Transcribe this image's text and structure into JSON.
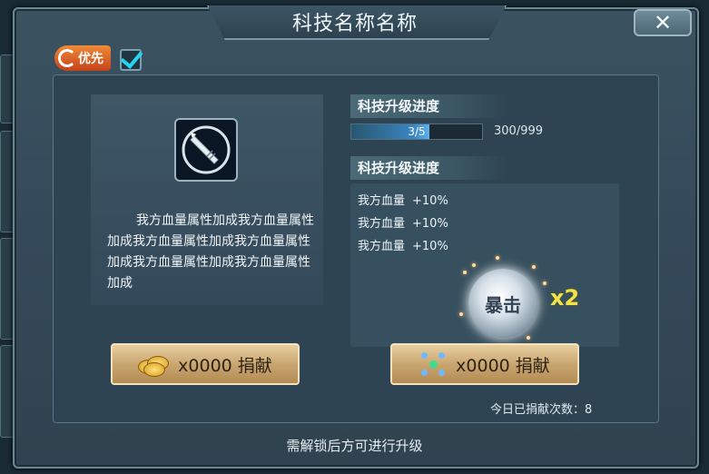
{
  "window": {
    "title": "科技名称名称",
    "close_icon": "close-icon"
  },
  "priority": {
    "label": "优先",
    "checked": true
  },
  "tech": {
    "icon": "bullet-icon",
    "description": "我方血量属性加成我方血量属性加成我方血量属性加成我方血量属性加成我方血量属性加成我方血量属性加成"
  },
  "progress": {
    "header": "科技升级进度",
    "level_text": "3/5",
    "level_fraction": 0.6,
    "exp_text": "300/999"
  },
  "attributes": {
    "header": "科技升级进度",
    "items": [
      {
        "name": "我方血量",
        "value": "+10%"
      },
      {
        "name": "我方血量",
        "value": "+10%"
      },
      {
        "name": "我方血量",
        "value": "+10%"
      }
    ]
  },
  "crit": {
    "label": "暴击",
    "multiplier": "x2"
  },
  "buttons": {
    "coin_donate": {
      "label": "x0000 捐献",
      "icon": "gold-coins-icon"
    },
    "item_donate": {
      "label": "x0000 捐献",
      "icon": "molecule-icon"
    }
  },
  "today_count": "今日已捐献次数：8",
  "footer": "需解锁后方可进行升级",
  "colors": {
    "accent_cyan": "#26d4f2",
    "priority_orange": "#e3672a",
    "crit_yellow": "#f2e24c"
  }
}
